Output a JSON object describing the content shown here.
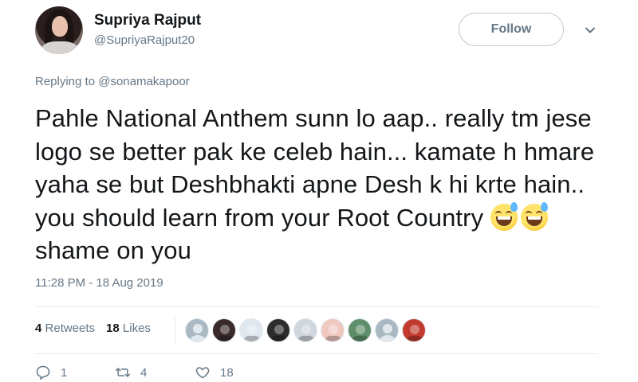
{
  "user": {
    "name": "Supriya Rajput",
    "handle": "@SupriyaRajput20",
    "follow_label": "Follow"
  },
  "reply": {
    "prefix": "Replying to",
    "target": "@sonamakapoor"
  },
  "tweet": {
    "text_main": "Pahle National Anthem sunn lo aap.. really tm jese logo se better pak ke celeb hain... kamate h hmare yaha se but Deshbhakti apne Desh k hi krte hain.. you should learn from your Root Country",
    "emojis": [
      "grinning-face-with-sweat",
      "grinning-face-with-sweat"
    ],
    "text_end": "shame on you",
    "timestamp": "11:28 PM - 18 Aug 2019"
  },
  "stats": {
    "retweets_count": "4",
    "retweets_label": "Retweets",
    "likes_count": "18",
    "likes_label": "Likes"
  },
  "likers": [
    {
      "icon": "avatar-default",
      "bg": "#aab8c2"
    },
    {
      "icon": "avatar-photo",
      "bg": "#3a2a2a"
    },
    {
      "icon": "avatar-photo",
      "bg": "#dfe7ef"
    },
    {
      "icon": "avatar-photo",
      "bg": "#2c2c2c"
    },
    {
      "icon": "avatar-photo",
      "bg": "#cfd6de"
    },
    {
      "icon": "avatar-photo",
      "bg": "#f0c8c0"
    },
    {
      "icon": "avatar-photo",
      "bg": "#5f8f6a"
    },
    {
      "icon": "avatar-default",
      "bg": "#aab8c2"
    },
    {
      "icon": "avatar-photo",
      "bg": "#c23a2e"
    }
  ],
  "actions": {
    "replies": "1",
    "retweets": "4",
    "likes": "18"
  },
  "colors": {
    "text": "#14171a",
    "secondary": "#657786",
    "border": "#e6ecf0"
  }
}
